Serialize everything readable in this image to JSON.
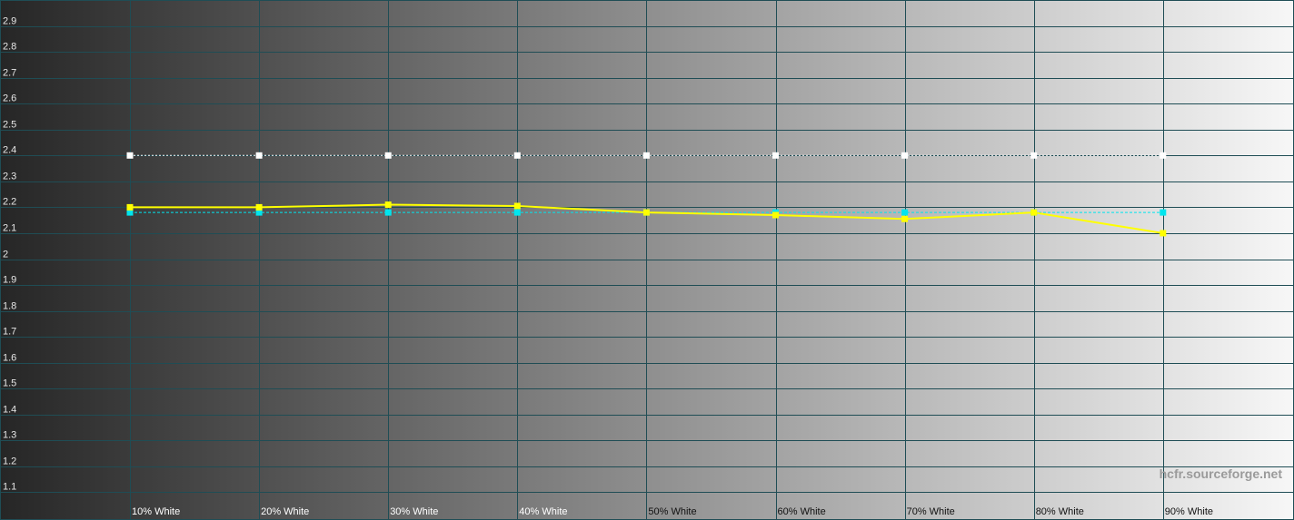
{
  "watermark": "hcfr.sourceforge.net",
  "colors": {
    "grid": "#1f4d55",
    "measured": "#ffff00",
    "reference": "#ffffff",
    "average": "#00e5ee",
    "gradient_start": "#262626",
    "gradient_end": "#f7f7f7"
  },
  "chart_data": {
    "type": "line",
    "title": "",
    "xlabel": "",
    "ylabel": "",
    "ylim": [
      1.0,
      3.0
    ],
    "yticks": [
      1.1,
      1.2,
      1.3,
      1.4,
      1.5,
      1.6,
      1.7,
      1.8,
      1.9,
      2,
      2.1,
      2.2,
      2.3,
      2.4,
      2.5,
      2.6,
      2.7,
      2.8,
      2.9
    ],
    "grid": true,
    "background": "grayscale gradient",
    "categories": [
      "10% White",
      "20% White",
      "30% White",
      "40% White",
      "50% White",
      "60% White",
      "70% White",
      "80% White",
      "90% White"
    ],
    "series": [
      {
        "values": [
          2.2,
          2.2,
          2.21,
          2.205,
          2.18,
          2.17,
          2.155,
          2.18,
          2.1
        ],
        "color": "#ffff00",
        "style": "solid"
      },
      {
        "values": [
          2.4,
          2.4,
          2.4,
          2.4,
          2.4,
          2.4,
          2.4,
          2.4,
          2.4
        ],
        "color": "#ffffff",
        "style": "dotted"
      },
      {
        "values": [
          2.18,
          2.18,
          2.18,
          2.18,
          2.18,
          2.18,
          2.18,
          2.18,
          2.18
        ],
        "color": "#00e5ee",
        "style": "dashed"
      }
    ]
  }
}
